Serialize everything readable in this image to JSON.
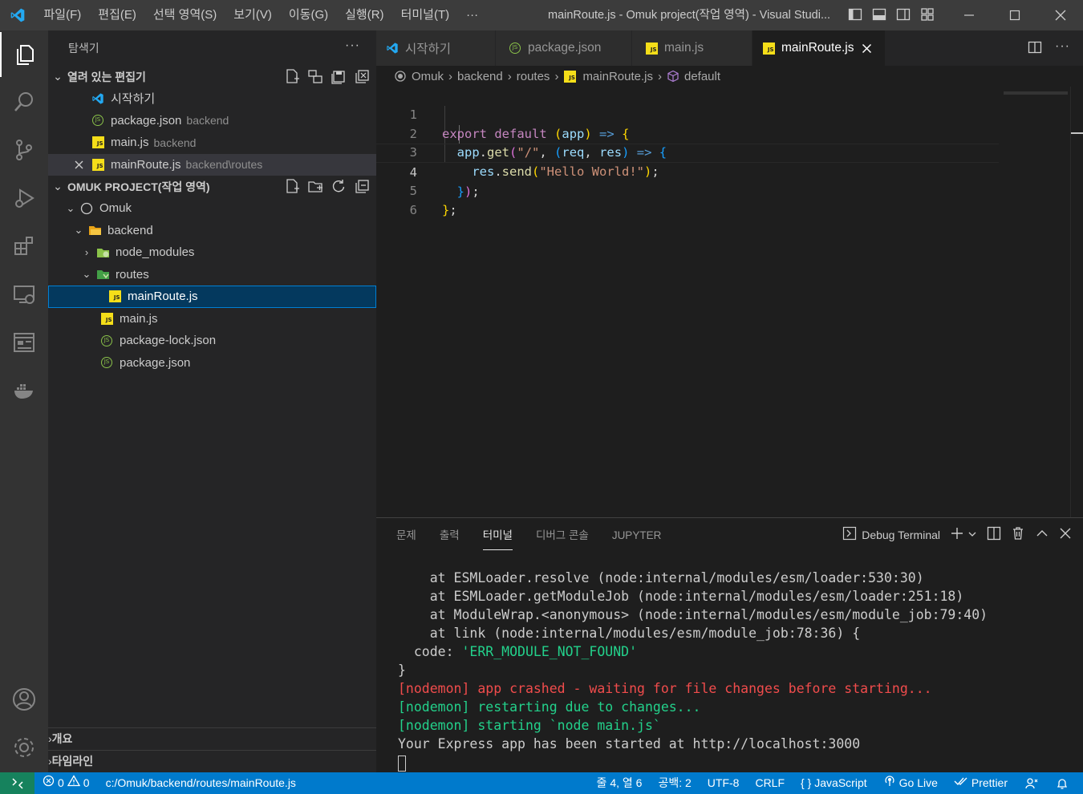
{
  "titlebar": {
    "menus": [
      "파일(F)",
      "편집(E)",
      "선택 영역(S)",
      "보기(V)",
      "이동(G)",
      "실행(R)",
      "터미널(T)",
      "···"
    ],
    "title": "mainRoute.js - Omuk project(작업 영역) - Visual Studi..."
  },
  "activity": {
    "icons": [
      "explorer-icon",
      "search-icon",
      "source-control-icon",
      "run-debug-icon",
      "extensions-icon",
      "remote-explorer-icon",
      "live-preview-icon",
      "docker-icon",
      "accounts-icon",
      "settings-gear-icon"
    ]
  },
  "sidebar": {
    "title": "탐색기",
    "more": "···",
    "open_editors": {
      "label": "열려 있는 편집기",
      "items": [
        {
          "name": "시작하기",
          "desc": ""
        },
        {
          "name": "package.json",
          "desc": "backend"
        },
        {
          "name": "main.js",
          "desc": "backend"
        },
        {
          "name": "mainRoute.js",
          "desc": "backend\\routes"
        }
      ]
    },
    "workspace": {
      "label": "OMUK PROJECT(작업 영역)",
      "items": [
        "Omuk",
        "backend",
        "node_modules",
        "routes",
        "mainRoute.js",
        "main.js",
        "package-lock.json",
        "package.json"
      ]
    },
    "outline_label": "개요",
    "timeline_label": "타임라인"
  },
  "tabs": [
    {
      "label": "시작하기"
    },
    {
      "label": "package.json"
    },
    {
      "label": "main.js"
    },
    {
      "label": "mainRoute.js"
    }
  ],
  "breadcrumb": [
    "Omuk",
    "backend",
    "routes",
    "mainRoute.js",
    "default"
  ],
  "editor": {
    "line_numbers": [
      "1",
      "2",
      "3",
      "4",
      "5",
      "6"
    ],
    "current_line": 4
  },
  "panel": {
    "tabs": [
      "문제",
      "출력",
      "터미널",
      "디버그 콘솔",
      "JUPYTER"
    ],
    "active_tab": "터미널",
    "terminal_name": "Debug Terminal",
    "lines": [
      "    at ESMLoader.resolve (node:internal/modules/esm/loader:530:30)",
      "    at ESMLoader.getModuleJob (node:internal/modules/esm/loader:251:18)",
      "    at ModuleWrap.<anonymous> (node:internal/modules/esm/module_job:79:40)",
      "    at link (node:internal/modules/esm/module_job:78:36) {",
      "  code: ",
      "'ERR_MODULE_NOT_FOUND'",
      "}",
      "[nodemon] app crashed - waiting for file changes before starting...",
      "[nodemon] restarting due to changes...",
      "[nodemon] starting `node main.js`",
      "Your Express app has been started at http://localhost:3000"
    ]
  },
  "status": {
    "errors": "0",
    "warnings": "0",
    "path": "c:/Omuk/backend/routes/mainRoute.js",
    "position": "줄 4, 열 6",
    "spaces": "공백: 2",
    "encoding": "UTF-8",
    "eol": "CRLF",
    "language": "JavaScript",
    "golive": "Go Live",
    "prettier": "Prettier"
  },
  "colors": {
    "accent": "#007acc",
    "remote": "#16825d",
    "js": "#f5de19",
    "json": "#8bc34a"
  }
}
